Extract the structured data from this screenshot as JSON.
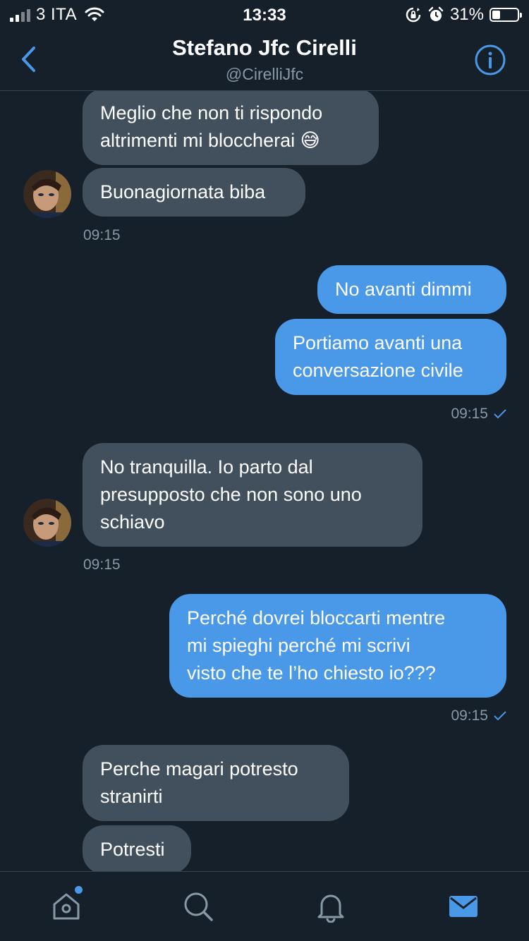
{
  "status": {
    "carrier": "3 ITA",
    "time": "13:33",
    "battery_pct": "31%",
    "battery_level": 0.31
  },
  "header": {
    "title": "Stefano Jfc Cirelli",
    "handle": "@CirelliJfc",
    "back_icon": "chevron-left-icon",
    "info_icon": "info-icon"
  },
  "messages": [
    {
      "side": "in",
      "text": "Meglio che non ti rispondo\naltrimenti mi bloccherai 😅"
    },
    {
      "side": "in",
      "text": "Buonagiornata biba",
      "time": "09:15"
    },
    {
      "side": "out",
      "text": "No avanti dimmi"
    },
    {
      "side": "out",
      "text": "Portiamo avanti una\nconversazione civile",
      "time": "09:15"
    },
    {
      "side": "in",
      "text": "No tranquilla.  Io parto dal\npresupposto che non sono uno\nschiavo",
      "time": "09:15"
    },
    {
      "side": "out",
      "text": "Perché dovrei bloccarti mentre\nmi spieghi perché mi scrivi\nvisto che te l’ho chiesto io???",
      "time": "09:15"
    },
    {
      "side": "in",
      "text": "Perche magari potresto\nstranirti"
    },
    {
      "side": "in",
      "text": "Potresti"
    }
  ],
  "tabs": [
    {
      "name": "home",
      "icon": "home-icon",
      "notification": true
    },
    {
      "name": "search",
      "icon": "search-icon"
    },
    {
      "name": "notifications",
      "icon": "bell-icon"
    },
    {
      "name": "messages",
      "icon": "mail-icon",
      "active": true
    }
  ],
  "colors": {
    "background": "#15202b",
    "accent": "#4a99e9",
    "incoming_bubble": "#42505e",
    "secondary_text": "#8899a6"
  }
}
